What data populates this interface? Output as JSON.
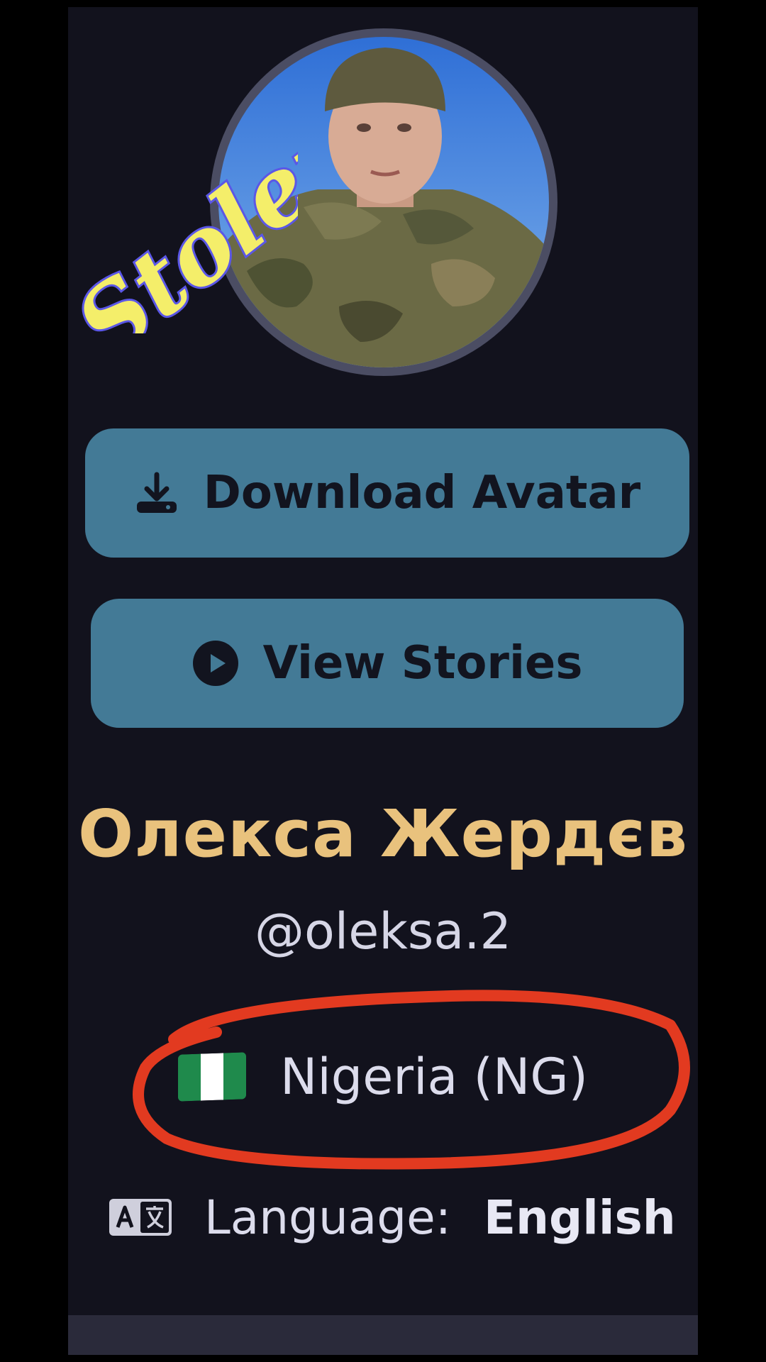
{
  "profile": {
    "download_avatar_label": "Download Avatar",
    "view_stories_label": "View Stories",
    "display_name": "Олекса Жердєв",
    "handle": "@oleksa.2",
    "country": "Nigeria (NG)",
    "language_label": "Language:",
    "language_value": "English"
  },
  "icons": {
    "download": "download-icon",
    "play": "play-circle-icon",
    "flag": "nigeria-flag-icon",
    "language": "translate-icon"
  },
  "overlay": {
    "stamp_text": "Stolen",
    "stamp_color": "#f4ee6a",
    "stamp_outline": "#5b57e6",
    "circle_color": "#e23a20"
  },
  "colors": {
    "background": "#12121d",
    "button": "#437a96",
    "name": "#e9c27d",
    "flag_green": "#1f8a4c",
    "flag_white": "#ffffff"
  }
}
